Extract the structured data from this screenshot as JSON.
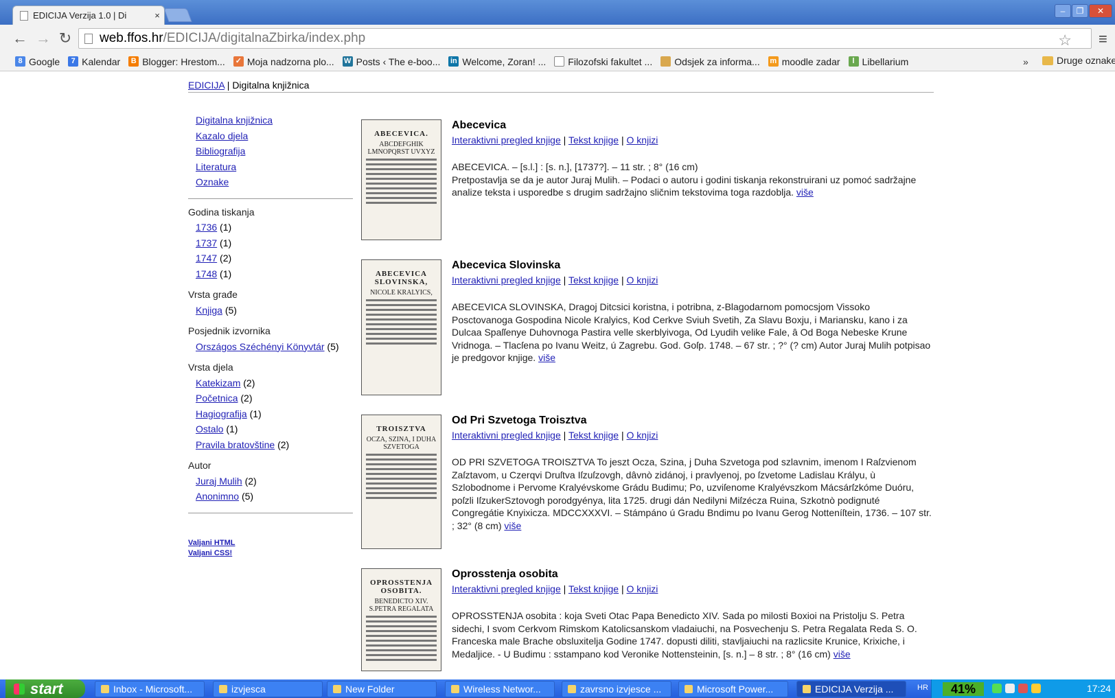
{
  "browser": {
    "tab_title": "EDICIJA Verzija 1.0 | Di",
    "tab_close": "×",
    "url_host": "web.ffos.hr",
    "url_path": "/EDICIJA/digitalnaZbirka/index.php",
    "window_controls": [
      "–",
      "❐",
      "✕"
    ]
  },
  "bookmarks": [
    {
      "label": "Google",
      "icon": "google-icon",
      "color": "#4a86e8",
      "glyph": "8"
    },
    {
      "label": "Kalendar",
      "icon": "calendar-icon",
      "color": "#3b78e7",
      "glyph": "7"
    },
    {
      "label": "Blogger: Hrestom...",
      "icon": "blogger-icon",
      "color": "#f57d00",
      "glyph": "B"
    },
    {
      "label": "Moja nadzorna plo...",
      "icon": "dashboard-icon",
      "color": "#e8763a",
      "glyph": "✓"
    },
    {
      "label": "Posts ‹ The e-boo...",
      "icon": "wordpress-icon",
      "color": "#21759b",
      "glyph": "W"
    },
    {
      "label": "Welcome, Zoran! ...",
      "icon": "linkedin-icon",
      "color": "#0e76a8",
      "glyph": "in"
    },
    {
      "label": "Filozofski fakultet ...",
      "icon": "page-icon",
      "color": "#ffffff",
      "glyph": ""
    },
    {
      "label": "Odsjek za informa...",
      "icon": "crest-icon",
      "color": "#d9a84e",
      "glyph": ""
    },
    {
      "label": "moodle zadar",
      "icon": "moodle-icon",
      "color": "#f49a1c",
      "glyph": "m"
    },
    {
      "label": "Libellarium",
      "icon": "libellarium-icon",
      "color": "#6aa84f",
      "glyph": "l"
    }
  ],
  "bookmarks_more": "»",
  "bookmarks_other": "Druge oznake",
  "breadcrumb": {
    "link": "EDICIJA",
    "current": "| Digitalna knjižnica"
  },
  "sidebar": {
    "nav": [
      "Digitalna knjižnica",
      "Kazalo djela",
      "Bibliografija",
      "Literatura",
      "Oznake"
    ],
    "facets": [
      {
        "title": "Godina tiskanja",
        "items": [
          {
            "label": "1736",
            "count": "(1)"
          },
          {
            "label": "1737",
            "count": "(1)"
          },
          {
            "label": "1747",
            "count": "(2)"
          },
          {
            "label": "1748",
            "count": "(1)"
          }
        ]
      },
      {
        "title": "Vrsta građe",
        "items": [
          {
            "label": "Knjiga",
            "count": "(5)"
          }
        ]
      },
      {
        "title": "Posjednik izvornika",
        "items": [
          {
            "label": "Országos Széchényi Könyvtár",
            "count": "(5)"
          }
        ]
      },
      {
        "title": "Vrsta djela",
        "items": [
          {
            "label": "Katekizam",
            "count": "(2)"
          },
          {
            "label": "Početnica",
            "count": "(2)"
          },
          {
            "label": "Hagiografija",
            "count": "(1)"
          },
          {
            "label": "Ostalo",
            "count": "(1)"
          },
          {
            "label": "Pravila bratovštine",
            "count": "(2)"
          }
        ]
      },
      {
        "title": "Autor",
        "items": [
          {
            "label": "Juraj Mulih",
            "count": "(2)"
          },
          {
            "label": "Anonimno",
            "count": "(5)"
          }
        ]
      }
    ],
    "valid_html": "Valjani HTML",
    "valid_css": "Valjani CSS!"
  },
  "entry_links": {
    "interactive": "Interaktivni pregled knjige",
    "text": "Tekst knjige",
    "about": "O knjizi",
    "more": "više"
  },
  "entries": [
    {
      "title": "Abecevica",
      "cover_title": "ABECEVICA.",
      "cover_sub": "ABCDEFGHIK LMNOPQRST UVXYZ",
      "desc_line1": "ABECEVICA. – [s.l.] : [s. n.], [1737?]. – 11 str. ; 8° (16 cm)",
      "desc": "Pretpostavlja se da je autor Juraj Mulih. – Podaci o autoru i godini tiskanja rekonstruirani uz pomoć sadržajne analize teksta i usporedbe s drugim sadržajno sličnim tekstovima toga razdoblja."
    },
    {
      "title": "Abecevica Slovinska",
      "cover_title": "ABECEVICA SLOVINSKA,",
      "cover_sub": "NICOLE KRALYICS,",
      "desc": "ABECEVICA SLOVINSKA, Dragoj Ditcsici koristna, i potribna, z-Blagodarnom pomocsjom Vissoko Posctovanoga Gospodina Nicole Kralyics, Kod Cerkve Sviuh Svetih, Za Slavu Boxju, i Mariansku, kano i za Dulcaa Spaſſenye Duhovnoga Pastira velle skerblyivoga, Od Lyudih velike Fale, â Od Boga Nebeske Krune Vridnoga. – Tlacſena po Ivanu Weitz, ú Zagrebu. God. Goſp. 1748. – 67 str. ; ?° (? cm) Autor Juraj Mulih potpisao je predgovor knjige."
    },
    {
      "title": "Od Pri Szvetoga Troisztva",
      "cover_title": "TROISZTVA",
      "cover_sub": "OCZA, SZINA, I DUHA SZVETOGA",
      "desc": "OD PRI SZVETOGA TROISZTVA To jeszt Ocza, Szina, j Duha Szvetoga pod szlavnim, imenom I Raſzvienom Zaſztavom, u Czerqvi Druſtva Iſzuſzovgh, dâvnò zidánoj, i pravlyenoj, po ſzvetome Ladislau Krályu, ù Szlobodnome i Pervome Kralyévskome Grádu Budimu; Po, uzviſenome Kralyévszkom Mácsárſzkóme Duóru, poſzli IſzukerSztovogh porodgyénya, lita 1725. drugi dán Nedilyni Miſzécza Ruina, Szkotnò podignuté Congregátie Knyixicza. MDCCXXXVI. – Stámpáno ú Gradu Bndimu po Ivanu Gerog Notteníſtein, 1736. – 107 str. ; 32° (8 cm)"
    },
    {
      "title": "Oprosstenja osobita",
      "cover_title": "OPROSSTENJA OSOBITA.",
      "cover_sub": "BENEDICTO XIV. S.PETRA REGALATA",
      "desc": "OPROSSTENJA osobita : koja Sveti Otac Papa Benedicto XIV. Sada po milosti Boxioi na Pristolju S. Petra sidechi, I svom Cerkvom Rimskom Katolicsanskom vladaiuchi, na Posvechenju S. Petra Regalata Reda S. O. Franceska male Brache obsluxitelja Godine 1747. dopusti diliti, stavljaiuchi na razlicsite Krunice, Krixiche, i Medaljice. - U Budimu : sstampano kod Veronike Nottensteinin, [s. n.] – 8 str. ; 8° (16 cm)"
    }
  ],
  "taskbar": {
    "start": "start",
    "tasks": [
      "Inbox - Microsoft...",
      "izvjesca",
      "New Folder",
      "Wireless Networ...",
      "zavrsno izvjesce ...",
      "Microsoft Power...",
      "EDICIJA Verzija ..."
    ],
    "lang": "HR",
    "battery": "41%",
    "clock": "17:24"
  }
}
